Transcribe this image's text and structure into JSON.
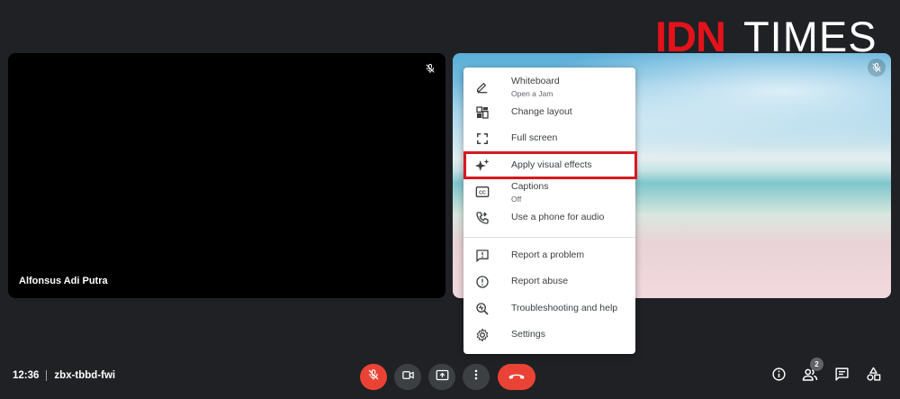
{
  "brand": {
    "part1": "IDN",
    "part2": "TIMES"
  },
  "tiles": {
    "left": {
      "participant_name": "Alfonsus Adi Putra",
      "mute_icon": "mic-off-icon"
    },
    "right": {
      "mute_icon": "mic-off-icon"
    }
  },
  "menu": {
    "items": [
      {
        "label": "Whiteboard",
        "sublabel": "Open a Jam",
        "icon": "pen-icon"
      },
      {
        "label": "Change layout",
        "icon": "layout-icon"
      },
      {
        "label": "Full screen",
        "icon": "fullscreen-icon"
      },
      {
        "label": "Apply visual effects",
        "icon": "sparkle-icon",
        "highlighted": true
      },
      {
        "label": "Captions",
        "sublabel": "Off",
        "icon": "captions-icon"
      },
      {
        "label": "Use a phone for audio",
        "icon": "phone-icon"
      },
      {
        "label": "Report a problem",
        "icon": "feedback-icon"
      },
      {
        "label": "Report abuse",
        "icon": "alert-icon"
      },
      {
        "label": "Troubleshooting and help",
        "icon": "troubleshoot-icon"
      },
      {
        "label": "Settings",
        "icon": "gear-icon"
      }
    ],
    "highlight_color": "#d71920"
  },
  "meeting": {
    "time": "12:36",
    "code": "zbx-tbbd-fwi"
  },
  "controls": {
    "mic": {
      "icon": "mic-off-icon",
      "state": "muted"
    },
    "camera": {
      "icon": "camera-icon"
    },
    "present": {
      "icon": "present-icon"
    },
    "more": {
      "icon": "more-vert-icon"
    },
    "end_call": {
      "icon": "end-call-icon"
    }
  },
  "side_controls": {
    "info": {
      "icon": "info-icon"
    },
    "people": {
      "icon": "people-icon",
      "count": "2"
    },
    "chat": {
      "icon": "chat-icon"
    },
    "activities": {
      "icon": "activities-icon"
    }
  },
  "colors": {
    "background": "#202124",
    "danger": "#ea4335",
    "button_dark": "#3c4043",
    "brand_red": "#e3121b"
  }
}
